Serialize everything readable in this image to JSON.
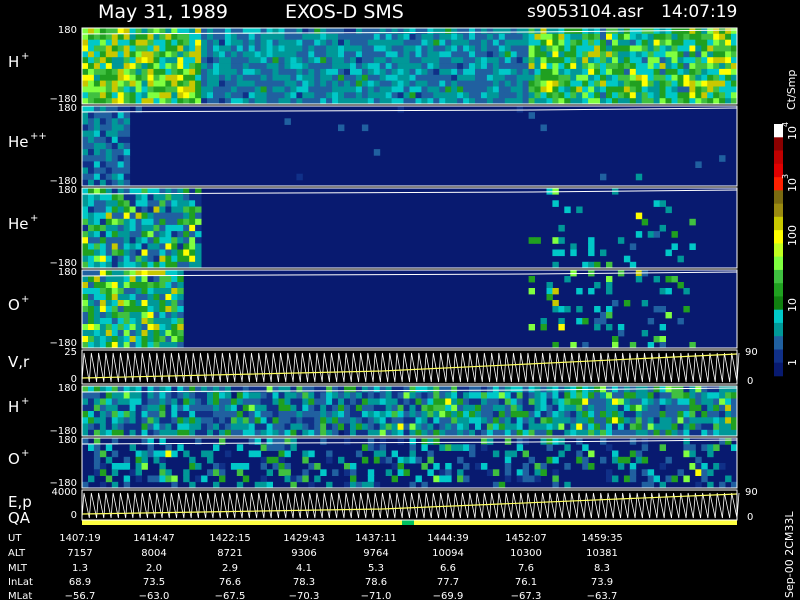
{
  "header": {
    "date": "May 31, 1989",
    "instrument": "EXOS-D SMS",
    "file": "s9053104.asr",
    "time": "14:07:19"
  },
  "chart_data": {
    "type": "heatmap",
    "panels": [
      {
        "id": "hplus1",
        "species": "H",
        "charge": "+",
        "ytop": "180",
        "ybot": "−180"
      },
      {
        "id": "hepp",
        "species": "He",
        "charge": "++",
        "ytop": "180",
        "ybot": "−180"
      },
      {
        "id": "hep",
        "species": "He",
        "charge": "+",
        "ytop": "180",
        "ybot": "−180"
      },
      {
        "id": "op1",
        "species": "O",
        "charge": "+",
        "ytop": "180",
        "ybot": "−180"
      },
      {
        "id": "vr",
        "species": "V,r",
        "charge": "",
        "ytop": "25",
        "ybot": "0",
        "rtop": "90",
        "rbot": "0"
      },
      {
        "id": "hplus2",
        "species": "H",
        "charge": "+",
        "ytop": "180",
        "ybot": "−180"
      },
      {
        "id": "op2",
        "species": "O",
        "charge": "+",
        "ytop": "180",
        "ybot": "−180"
      },
      {
        "id": "ep",
        "species": "E,p",
        "species2": "QA",
        "charge": "",
        "ytop": "4000",
        "ybot": "0",
        "rtop": "90",
        "rbot": "0"
      }
    ],
    "colorbar": {
      "unit": "Ct/Smp",
      "ticks": [
        {
          "label": "10",
          "exp": "4"
        },
        {
          "label": "10",
          "exp": "3"
        },
        {
          "label": "100",
          "exp": ""
        },
        {
          "label": "10",
          "exp": ""
        },
        {
          "label": "1",
          "exp": ""
        }
      ],
      "colors": [
        "#ffffff",
        "#8b0000",
        "#c00000",
        "#e00000",
        "#ff2000",
        "#7a6a10",
        "#9a8a10",
        "#c8c800",
        "#ffff00",
        "#c0ff20",
        "#80ff40",
        "#40c040",
        "#20a020",
        "#108010",
        "#00c8c8",
        "#009898",
        "#2060a0",
        "#103088",
        "#081a70"
      ]
    },
    "table": {
      "row_labels": [
        "UT",
        "ALT",
        "MLT",
        "InLat",
        "MLat"
      ],
      "columns": [
        [
          "1407:19",
          "7157",
          "1.3",
          "68.9",
          "−56.7"
        ],
        [
          "1414:47",
          "8004",
          "2.0",
          "73.5",
          "−63.0"
        ],
        [
          "1422:15",
          "8721",
          "2.9",
          "76.6",
          "−67.5"
        ],
        [
          "1429:43",
          "9306",
          "4.1",
          "78.3",
          "−70.3"
        ],
        [
          "1437:11",
          "9764",
          "5.3",
          "78.6",
          "−71.0"
        ],
        [
          "1444:39",
          "10094",
          "6.6",
          "77.7",
          "−69.9"
        ],
        [
          "1452:07",
          "10300",
          "7.6",
          "76.1",
          "−67.3"
        ],
        [
          "1459:35",
          "10381",
          "8.3",
          "73.9",
          "−63.7"
        ]
      ]
    },
    "footer": "Sep-00 2CM33L"
  }
}
